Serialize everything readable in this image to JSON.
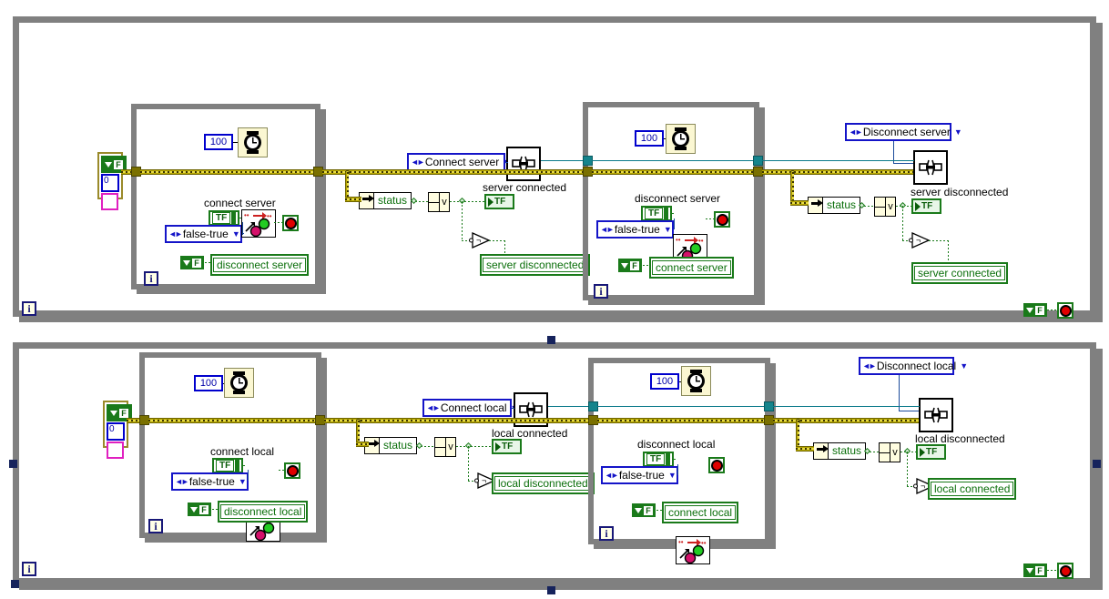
{
  "app": {
    "title": "LabVIEW Block Diagram",
    "canvas_bg": "#ffffff",
    "structure_color": "#808080",
    "wire_cluster_color": "#b8a800",
    "wire_bool_color": "#1a7a1a",
    "wire_blue_color": "#1a4a9a",
    "wire_teal_color": "#0a7a8a",
    "constant_blue": "#0000cd",
    "enum_blue": "#1414c8",
    "green": "#1a7a1a"
  },
  "diagrams": [
    {
      "id": "server-diagram",
      "target": "server",
      "iteration_label": "i",
      "loop1": {
        "wait_value": "100",
        "wait_icon": "clock-icon",
        "caption": "connect server",
        "bool_constant": "TF",
        "enum_value": "false-true",
        "local_var": "disconnect server",
        "iteration_label": "i",
        "stop_icon": "stop-button-icon",
        "led_icon": "select-led-icon"
      },
      "middle": {
        "enum_value": "Connect server",
        "subvi_icon": "subvi-icon",
        "status_label": "status",
        "or_label": "v",
        "indicator_caption": "server connected",
        "indicator_value": "TF",
        "not_icon": "not-gate-icon",
        "local_var": "server disconnected"
      },
      "loop2": {
        "wait_value": "100",
        "wait_icon": "clock-icon",
        "caption": "disconnect server",
        "bool_constant": "TF",
        "enum_value": "false-true",
        "local_var": "connect server",
        "iteration_label": "i",
        "stop_icon": "stop-button-icon",
        "led_icon": "select-led-icon"
      },
      "right": {
        "enum_value": "Disconnect server",
        "subvi_icon": "subvi-icon",
        "status_label": "status",
        "or_label": "v",
        "indicator_caption": "server disconnected",
        "indicator_value": "TF",
        "not_icon": "not-gate-icon",
        "local_var": "server connected"
      },
      "stop_row": {
        "bool_glyph": "F",
        "stop_icon": "stop-button-icon"
      },
      "cluster_constant": {
        "bool_glyph": "F",
        "numeric": "0",
        "string": ""
      }
    },
    {
      "id": "local-diagram",
      "target": "local",
      "iteration_label": "i",
      "loop1": {
        "wait_value": "100",
        "wait_icon": "clock-icon",
        "caption": "connect local",
        "bool_constant": "TF",
        "enum_value": "false-true",
        "local_var": "disconnect local",
        "iteration_label": "i",
        "stop_icon": "stop-button-icon",
        "led_icon": "select-led-icon"
      },
      "middle": {
        "enum_value": "Connect local",
        "subvi_icon": "subvi-icon",
        "status_label": "status",
        "or_label": "v",
        "indicator_caption": "local connected",
        "indicator_value": "TF",
        "not_icon": "not-gate-icon",
        "local_var": "local disconnected"
      },
      "loop2": {
        "wait_value": "100",
        "wait_icon": "clock-icon",
        "caption": "disconnect local",
        "bool_constant": "TF",
        "enum_value": "false-true",
        "local_var": "connect local",
        "iteration_label": "i",
        "stop_icon": "stop-button-icon",
        "led_icon": "select-led-icon"
      },
      "right": {
        "enum_value": "Disconnect local",
        "subvi_icon": "subvi-icon",
        "status_label": "status",
        "or_label": "v",
        "indicator_caption": "local disconnected",
        "indicator_value": "TF",
        "not_icon": "not-gate-icon",
        "local_var": "local connected"
      },
      "stop_row": {
        "bool_glyph": "F",
        "stop_icon": "stop-button-icon"
      },
      "cluster_constant": {
        "bool_glyph": "F",
        "numeric": "0",
        "string": ""
      }
    }
  ]
}
